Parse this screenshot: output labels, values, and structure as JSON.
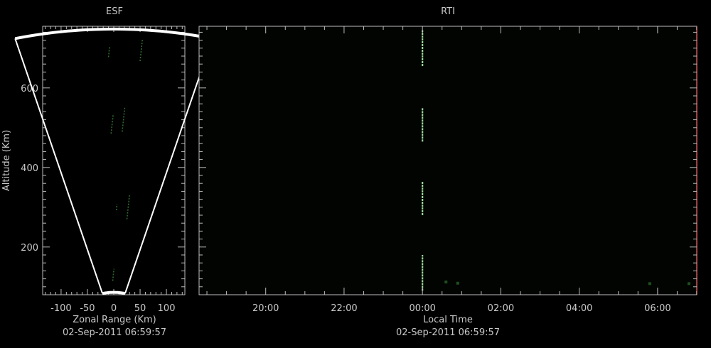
{
  "chart_data": [
    {
      "type": "scatter",
      "title": "ESF",
      "xlabel": "Zonal Range (Km)",
      "ylabel": "Altitude (Km)",
      "footer": "02-Sep-2011 06:59:57",
      "xlim": [
        -135,
        135
      ],
      "ylim": [
        80,
        755
      ],
      "x_tick_labels": [
        -100,
        -50,
        0,
        50,
        100
      ],
      "y_tick_labels": [
        200,
        400,
        600
      ],
      "x_minor_step": 10,
      "y_minor_step": 20,
      "beam": {
        "left_deg": -14.5,
        "right_deg": 14.5,
        "r_min": 86,
        "r_max": 748
      },
      "echoes": [
        {
          "x": 50,
          "y": 695,
          "len": 55
        },
        {
          "x": 16,
          "y": 520,
          "len": 60
        },
        {
          "x": -5,
          "y": 510,
          "len": 50
        },
        {
          "x": -10,
          "y": 690,
          "len": 25
        },
        {
          "x": 25,
          "y": 300,
          "len": 60
        },
        {
          "x": 5,
          "y": 300,
          "len": 15
        },
        {
          "x": -2,
          "y": 130,
          "len": 30
        }
      ],
      "grid": false,
      "color": "#2f6b2f"
    },
    {
      "type": "scatter",
      "title": "RTI",
      "xlabel": "Local Time",
      "ylabel": "",
      "footer": "02-Sep-2011 06:59:57",
      "xlim": [
        18.3,
        31.0
      ],
      "ylim": [
        80,
        755
      ],
      "x_ticks": [
        20,
        22,
        24,
        26,
        28,
        30
      ],
      "x_tick_labels": [
        "20:00",
        "22:00",
        "00:00",
        "02:00",
        "04:00",
        "06:00"
      ],
      "x_minor_step": 0.5,
      "y_ticks": [
        200,
        400,
        600
      ],
      "y_minor_step": 20,
      "echo_time": 24.0,
      "echo_segments": [
        [
          90,
          180
        ],
        [
          280,
          365
        ],
        [
          465,
          550
        ],
        [
          655,
          745
        ]
      ],
      "weak_echoes": [
        {
          "t": 24.6,
          "y": 112
        },
        {
          "t": 24.9,
          "y": 109
        },
        {
          "t": 29.8,
          "y": 108
        },
        {
          "t": 30.8,
          "y": 108
        }
      ],
      "current_time": 31.0,
      "grid": false,
      "color": "#9bd69b",
      "current_time_color": "#c03030"
    }
  ]
}
